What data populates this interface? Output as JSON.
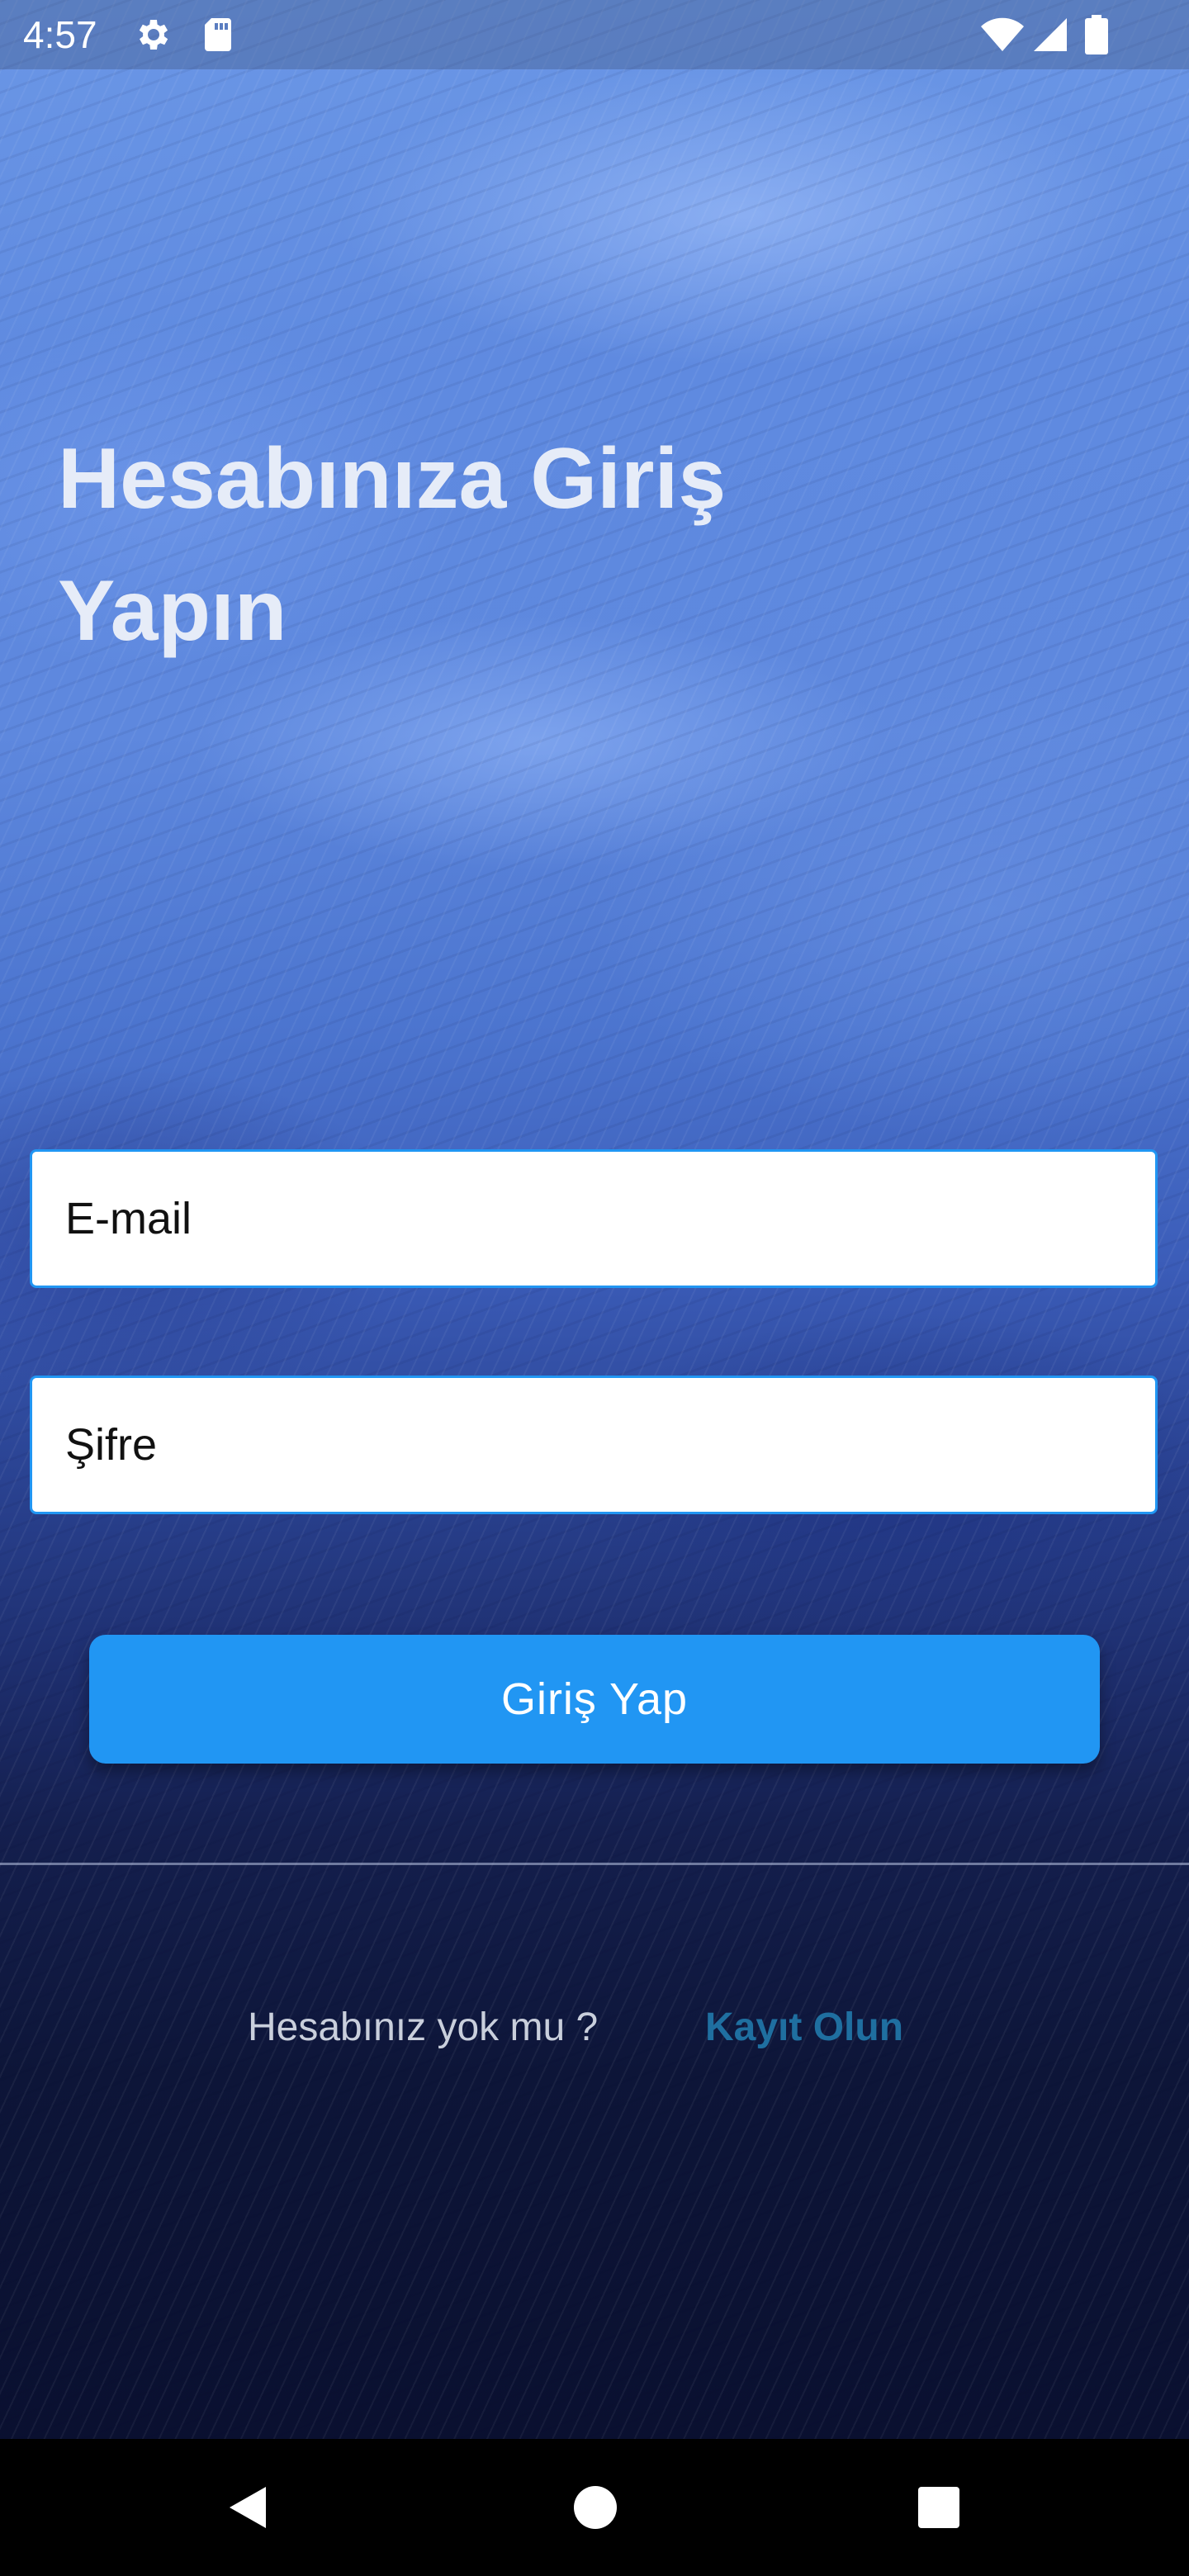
{
  "status_bar": {
    "time": "4:57",
    "icons": [
      "settings-gear-icon",
      "sd-card-icon",
      "wifi-icon",
      "signal-icon",
      "battery-icon"
    ]
  },
  "login": {
    "title_line1": "Hesabınıza Giriş",
    "title_line2": "Yapın",
    "email_placeholder": "E-mail",
    "password_placeholder": "Şifre",
    "login_button": "Giriş Yap",
    "no_account_text": "Hesabınız yok mu ?",
    "signup_link": "Kayıt Olun"
  },
  "nav_bar": {
    "buttons": [
      "back-icon",
      "home-icon",
      "recents-icon"
    ]
  },
  "colors": {
    "accent": "#2196f3",
    "link": "#1f6fa0",
    "title_text": "#e6ecf8"
  }
}
